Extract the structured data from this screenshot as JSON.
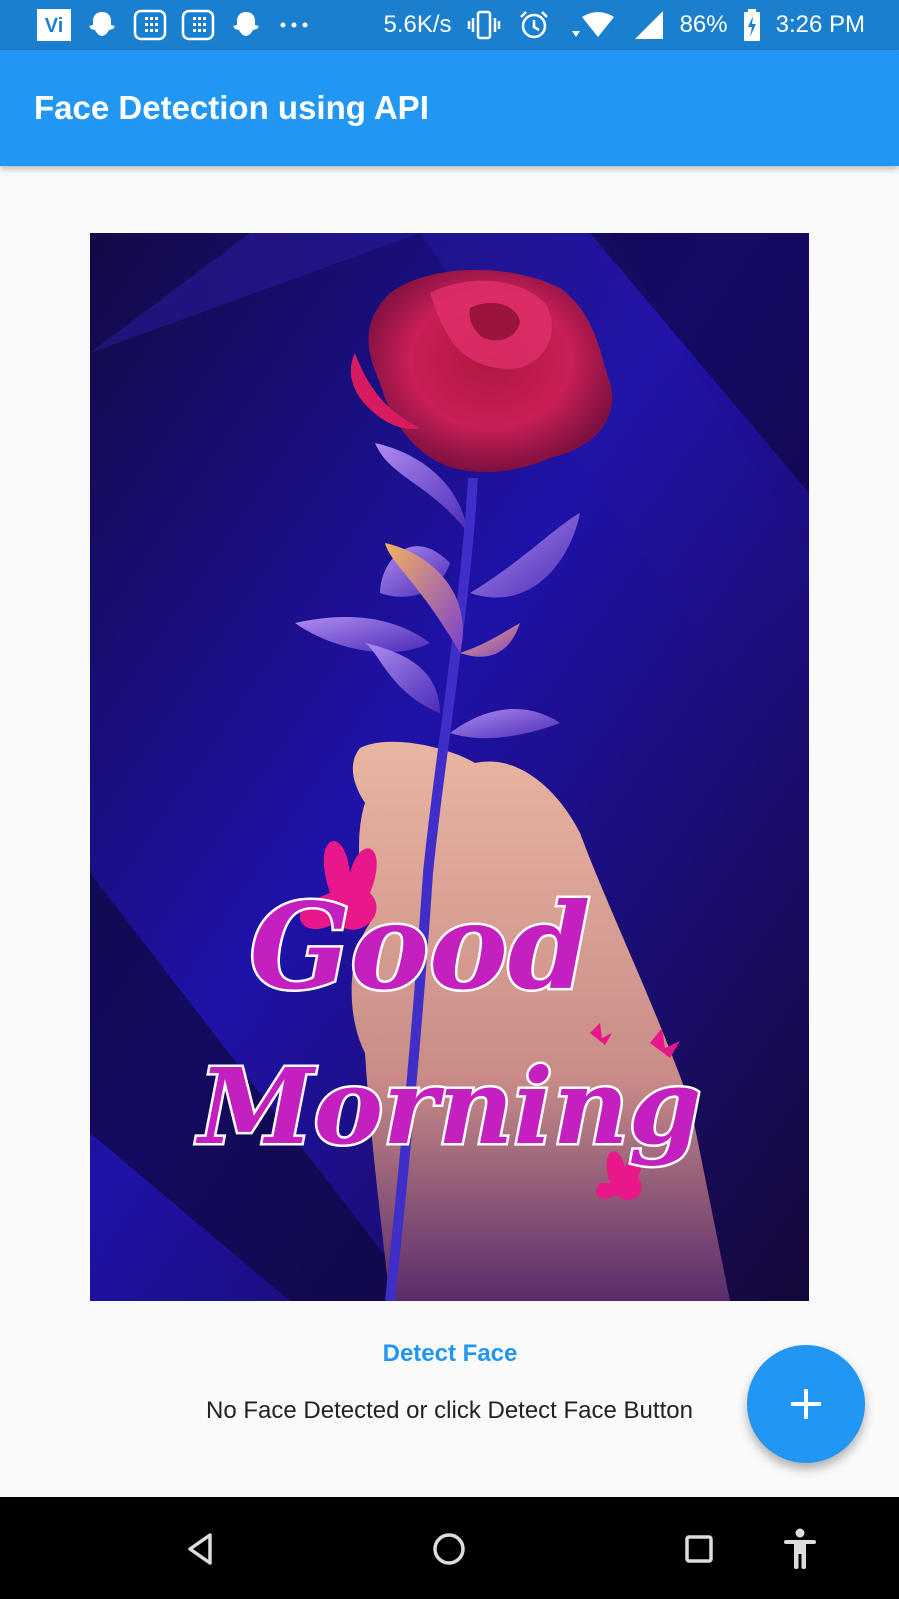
{
  "status_bar": {
    "net_speed": "5.6K/s",
    "battery": "86%",
    "time": "3:26 PM",
    "carrier_logo": "Vi",
    "icons": [
      "vi-carrier-icon",
      "snapchat-icon",
      "calculator-icon",
      "calculator-icon",
      "snapchat-icon",
      "more-dots-icon",
      "vibrate-icon",
      "alarm-icon",
      "wifi-icon",
      "signal-icon",
      "battery-charging-icon"
    ]
  },
  "app_bar": {
    "title": "Face Detection using API"
  },
  "image": {
    "greeting_line1": "Good",
    "greeting_line2": "Morning"
  },
  "detect_button": {
    "label": "Detect Face"
  },
  "result_text": "No Face Detected or click Detect Face Button",
  "fab": {
    "icon": "plus-icon"
  },
  "nav_bar": {
    "icons": [
      "back-icon",
      "home-icon",
      "recents-icon",
      "accessibility-icon"
    ]
  },
  "colors": {
    "primary": "#2196f3",
    "status_bar": "#1b7fd0",
    "background": "#fafafa"
  }
}
